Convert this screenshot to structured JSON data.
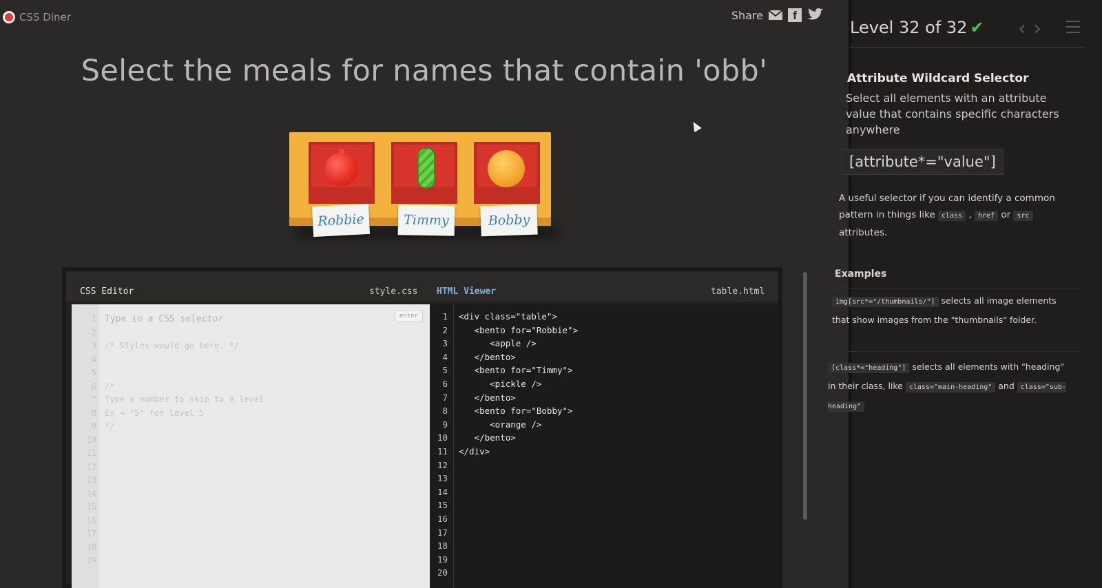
{
  "app": {
    "name": "CSS Diner"
  },
  "share": {
    "label": "Share",
    "icons": [
      "mail-icon",
      "facebook-icon",
      "twitter-icon"
    ]
  },
  "instruction": "Select the meals for names that contain 'obb'",
  "table": {
    "bentos": [
      {
        "food": "apple",
        "name": "Robbie"
      },
      {
        "food": "pickle",
        "name": "Timmy"
      },
      {
        "food": "orange",
        "name": "Bobby"
      }
    ]
  },
  "editor": {
    "css_label": "CSS Editor",
    "css_file": "style.css",
    "enter_label": "enter",
    "css_lines": [
      "Type in a CSS selector",
      "",
      "/* Styles would go here. */",
      "",
      "",
      "/*",
      "Type a number to skip to a level.",
      "Ex → \"5\" for level 5",
      "*/",
      "",
      "",
      "",
      "",
      "",
      "",
      "",
      "",
      "",
      ""
    ],
    "html_label": "HTML Viewer",
    "html_file": "table.html",
    "html_lines": [
      "<div class=\"table\">",
      "   <bento for=\"Robbie\">",
      "      <apple />",
      "   </bento>",
      "   <bento for=\"Timmy\">",
      "      <pickle />",
      "   </bento>",
      "   <bento for=\"Bobby\">",
      "      <orange />",
      "   </bento>",
      "</div>",
      "",
      "",
      "",
      "",
      "",
      "",
      "",
      "",
      ""
    ]
  },
  "sidebar": {
    "level_text": "Level 32 of 32",
    "check": "✔",
    "selector_name": "Attribute Wildcard Selector",
    "description": "Select all elements with an attribute value that contains specific characters anywhere",
    "syntax": "[attribute*=\"value\"]",
    "hint_pre": "A useful selector if you can identify a common pattern in things like",
    "hint_codes": [
      "class",
      "href",
      "src"
    ],
    "hint_sep": ",",
    "hint_or": "or",
    "hint_post": "attributes.",
    "examples_title": "Examples",
    "example1_code": "img[src*=\"/thumbnails/\"]",
    "example1_text": "selects all image elements that show images from the \"thumbnails\" folder.",
    "example2_code": "[class*=\"heading\"]",
    "example2_text": "selects all elements with \"heading\" in their class, like",
    "example2_code2": "class=\"main-heading\"",
    "example2_and": "and",
    "example2_code3": "class=\"sub-heading\""
  },
  "colors": {
    "accent_check": "#4cc24a",
    "bento_red": "#d7352c",
    "table_yellow": "#f3b23d",
    "nametag_text": "#3a86b5"
  }
}
